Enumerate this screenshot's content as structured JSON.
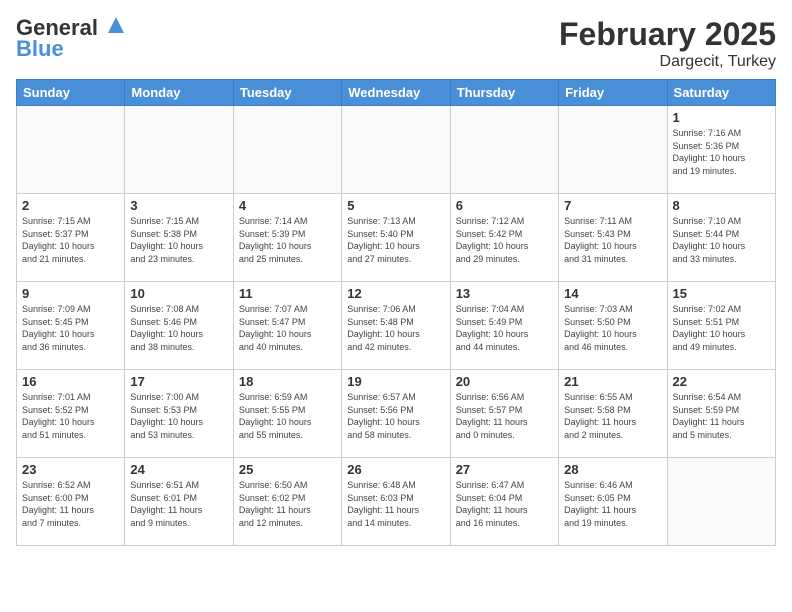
{
  "header": {
    "logo_line1": "General",
    "logo_line2": "Blue",
    "title": "February 2025",
    "subtitle": "Dargecit, Turkey"
  },
  "days_of_week": [
    "Sunday",
    "Monday",
    "Tuesday",
    "Wednesday",
    "Thursday",
    "Friday",
    "Saturday"
  ],
  "weeks": [
    [
      {
        "day": "",
        "info": ""
      },
      {
        "day": "",
        "info": ""
      },
      {
        "day": "",
        "info": ""
      },
      {
        "day": "",
        "info": ""
      },
      {
        "day": "",
        "info": ""
      },
      {
        "day": "",
        "info": ""
      },
      {
        "day": "1",
        "info": "Sunrise: 7:16 AM\nSunset: 5:36 PM\nDaylight: 10 hours\nand 19 minutes."
      }
    ],
    [
      {
        "day": "2",
        "info": "Sunrise: 7:15 AM\nSunset: 5:37 PM\nDaylight: 10 hours\nand 21 minutes."
      },
      {
        "day": "3",
        "info": "Sunrise: 7:15 AM\nSunset: 5:38 PM\nDaylight: 10 hours\nand 23 minutes."
      },
      {
        "day": "4",
        "info": "Sunrise: 7:14 AM\nSunset: 5:39 PM\nDaylight: 10 hours\nand 25 minutes."
      },
      {
        "day": "5",
        "info": "Sunrise: 7:13 AM\nSunset: 5:40 PM\nDaylight: 10 hours\nand 27 minutes."
      },
      {
        "day": "6",
        "info": "Sunrise: 7:12 AM\nSunset: 5:42 PM\nDaylight: 10 hours\nand 29 minutes."
      },
      {
        "day": "7",
        "info": "Sunrise: 7:11 AM\nSunset: 5:43 PM\nDaylight: 10 hours\nand 31 minutes."
      },
      {
        "day": "8",
        "info": "Sunrise: 7:10 AM\nSunset: 5:44 PM\nDaylight: 10 hours\nand 33 minutes."
      }
    ],
    [
      {
        "day": "9",
        "info": "Sunrise: 7:09 AM\nSunset: 5:45 PM\nDaylight: 10 hours\nand 36 minutes."
      },
      {
        "day": "10",
        "info": "Sunrise: 7:08 AM\nSunset: 5:46 PM\nDaylight: 10 hours\nand 38 minutes."
      },
      {
        "day": "11",
        "info": "Sunrise: 7:07 AM\nSunset: 5:47 PM\nDaylight: 10 hours\nand 40 minutes."
      },
      {
        "day": "12",
        "info": "Sunrise: 7:06 AM\nSunset: 5:48 PM\nDaylight: 10 hours\nand 42 minutes."
      },
      {
        "day": "13",
        "info": "Sunrise: 7:04 AM\nSunset: 5:49 PM\nDaylight: 10 hours\nand 44 minutes."
      },
      {
        "day": "14",
        "info": "Sunrise: 7:03 AM\nSunset: 5:50 PM\nDaylight: 10 hours\nand 46 minutes."
      },
      {
        "day": "15",
        "info": "Sunrise: 7:02 AM\nSunset: 5:51 PM\nDaylight: 10 hours\nand 49 minutes."
      }
    ],
    [
      {
        "day": "16",
        "info": "Sunrise: 7:01 AM\nSunset: 5:52 PM\nDaylight: 10 hours\nand 51 minutes."
      },
      {
        "day": "17",
        "info": "Sunrise: 7:00 AM\nSunset: 5:53 PM\nDaylight: 10 hours\nand 53 minutes."
      },
      {
        "day": "18",
        "info": "Sunrise: 6:59 AM\nSunset: 5:55 PM\nDaylight: 10 hours\nand 55 minutes."
      },
      {
        "day": "19",
        "info": "Sunrise: 6:57 AM\nSunset: 5:56 PM\nDaylight: 10 hours\nand 58 minutes."
      },
      {
        "day": "20",
        "info": "Sunrise: 6:56 AM\nSunset: 5:57 PM\nDaylight: 11 hours\nand 0 minutes."
      },
      {
        "day": "21",
        "info": "Sunrise: 6:55 AM\nSunset: 5:58 PM\nDaylight: 11 hours\nand 2 minutes."
      },
      {
        "day": "22",
        "info": "Sunrise: 6:54 AM\nSunset: 5:59 PM\nDaylight: 11 hours\nand 5 minutes."
      }
    ],
    [
      {
        "day": "23",
        "info": "Sunrise: 6:52 AM\nSunset: 6:00 PM\nDaylight: 11 hours\nand 7 minutes."
      },
      {
        "day": "24",
        "info": "Sunrise: 6:51 AM\nSunset: 6:01 PM\nDaylight: 11 hours\nand 9 minutes."
      },
      {
        "day": "25",
        "info": "Sunrise: 6:50 AM\nSunset: 6:02 PM\nDaylight: 11 hours\nand 12 minutes."
      },
      {
        "day": "26",
        "info": "Sunrise: 6:48 AM\nSunset: 6:03 PM\nDaylight: 11 hours\nand 14 minutes."
      },
      {
        "day": "27",
        "info": "Sunrise: 6:47 AM\nSunset: 6:04 PM\nDaylight: 11 hours\nand 16 minutes."
      },
      {
        "day": "28",
        "info": "Sunrise: 6:46 AM\nSunset: 6:05 PM\nDaylight: 11 hours\nand 19 minutes."
      },
      {
        "day": "",
        "info": ""
      }
    ]
  ]
}
